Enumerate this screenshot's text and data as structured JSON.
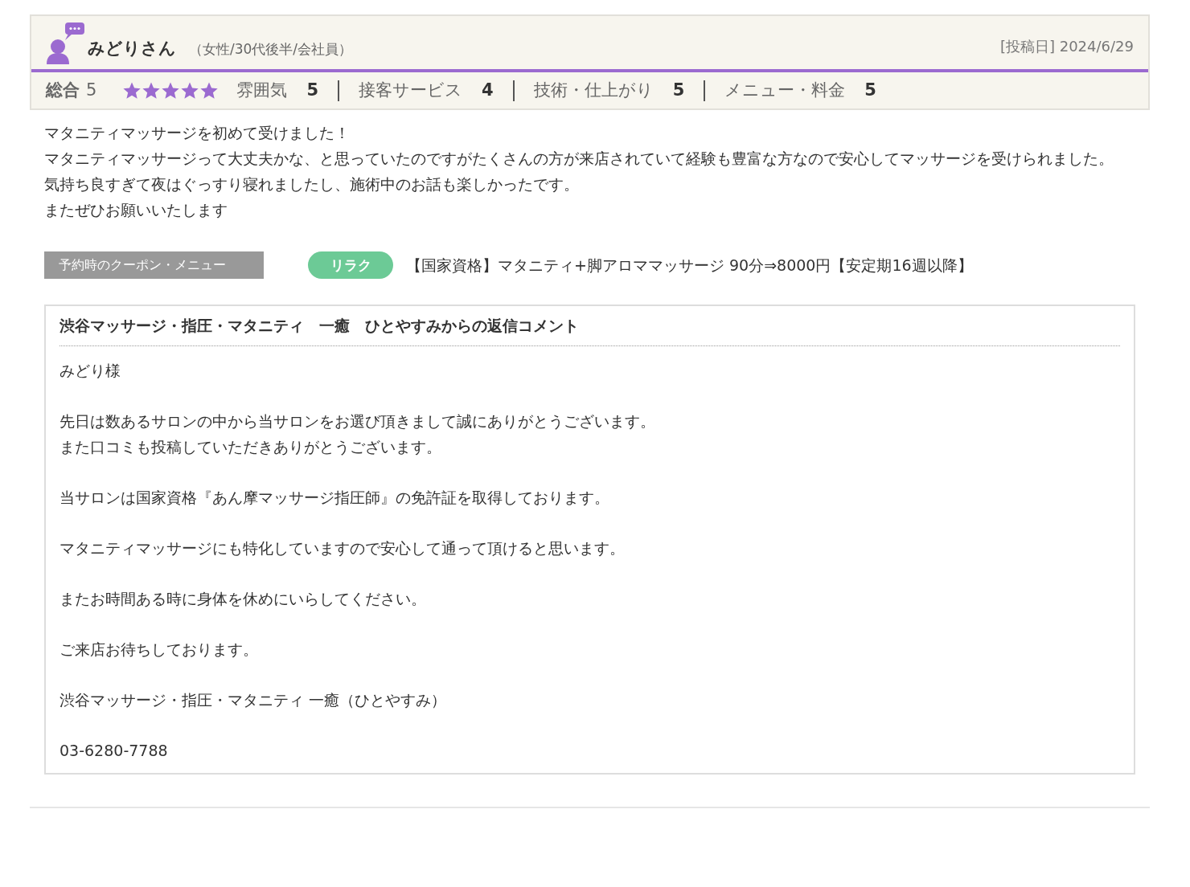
{
  "reviewer": {
    "name": "みどりさん",
    "profile": "（女性/30代後半/会社員）",
    "posted": "[投稿日] 2024/6/29"
  },
  "ratings": {
    "overall_label": "総合",
    "overall_value": "5",
    "stars": 5,
    "items": [
      {
        "label": "雰囲気",
        "value": "5"
      },
      {
        "label": "接客サービス",
        "value": "4"
      },
      {
        "label": "技術・仕上がり",
        "value": "5"
      },
      {
        "label": "メニュー・料金",
        "value": "5"
      }
    ]
  },
  "review_lines": [
    "マタニティマッサージを初めて受けました！",
    "マタニティマッサージって大丈夫かな、と思っていたのですがたくさんの方が来店されていて経験も豊富な方なので安心してマッサージを受けられました。",
    "気持ち良すぎて夜はぐっすり寝れましたし、施術中のお話も楽しかったです。",
    "またぜひお願いいたします"
  ],
  "coupon": {
    "label": "予約時のクーポン・メニュー",
    "tag": "リラク",
    "text": "【国家資格】マタニティ+脚アロママッサージ 90分⇒8000円【安定期16週以降】"
  },
  "reply": {
    "title": "渋谷マッサージ・指圧・マタニティ　一癒　ひとやすみからの返信コメント",
    "paragraphs": [
      [
        "みどり様"
      ],
      [
        "先日は数あるサロンの中から当サロンをお選び頂きまして誠にありがとうございます。",
        "また口コミも投稿していただきありがとうございます。"
      ],
      [
        "当サロンは国家資格『あん摩マッサージ指圧師』の免許証を取得しております。"
      ],
      [
        "マタニティマッサージにも特化していますので安心して通って頂けると思います。"
      ],
      [
        "またお時間ある時に身体を休めにいらしてください。"
      ],
      [
        "ご来店お待ちしております。"
      ],
      [
        "渋谷マッサージ・指圧・マタニティ 一癒（ひとやすみ）"
      ],
      [
        "03-6280-7788"
      ]
    ]
  }
}
